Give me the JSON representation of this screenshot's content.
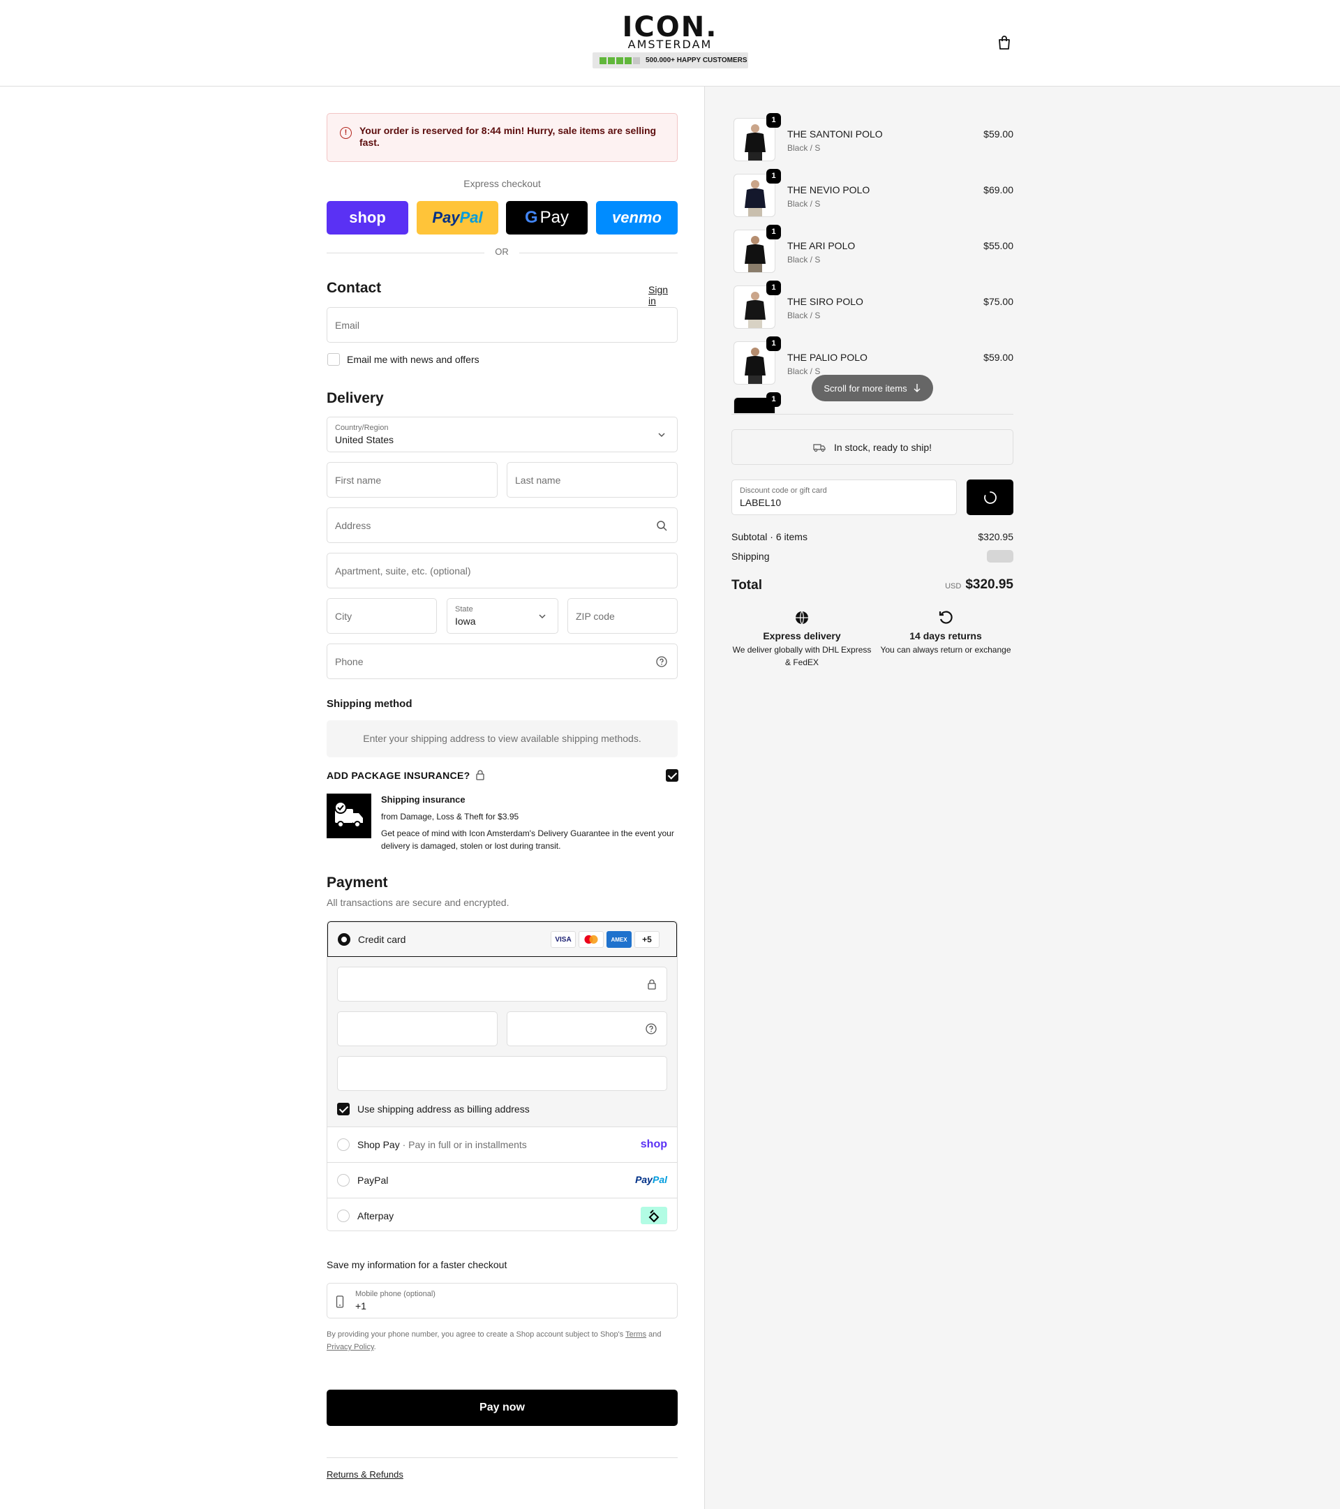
{
  "header": {
    "logo_main": "ICON.",
    "logo_sub": "AMSTERDAM",
    "trust_text": "500.000+ HAPPY CUSTOMERS",
    "trust_rating_stars": 4,
    "trust_rating_max": 5
  },
  "alert": {
    "icon": "alert-circle-icon",
    "text": "Your order is reserved for 8:44 min! Hurry, sale items are selling fast."
  },
  "express": {
    "label": "Express checkout",
    "shop": "shop",
    "paypal_a": "Pay",
    "paypal_b": "Pal",
    "gpay_g": "G",
    "gpay": "Pay",
    "venmo": "venmo",
    "or": "OR"
  },
  "contact": {
    "title": "Contact",
    "sign_in": "Sign in",
    "email_placeholder": "Email",
    "news_label": "Email me with news and offers"
  },
  "delivery": {
    "title": "Delivery",
    "country_label": "Country/Region",
    "country_value": "United States",
    "first_name": "First name",
    "last_name": "Last name",
    "address": "Address",
    "apartment": "Apartment, suite, etc. (optional)",
    "city": "City",
    "state_label": "State",
    "state_value": "Iowa",
    "zip": "ZIP code",
    "phone": "Phone"
  },
  "shipping_method": {
    "title": "Shipping method",
    "message": "Enter your shipping address to view available shipping methods."
  },
  "insurance": {
    "title": "ADD PACKAGE INSURANCE?",
    "checked": true,
    "heading": "Shipping insurance",
    "sub": "from Damage, Loss & Theft for $3.95",
    "desc": "Get peace of mind with Icon Amsterdam's Delivery Guarantee in the event your delivery is damaged, stolen or lost during transit."
  },
  "payment": {
    "title": "Payment",
    "subtitle": "All transactions are secure and encrypted.",
    "credit_card": "Credit card",
    "cards": [
      "VISA",
      "AMEX",
      "+5"
    ],
    "billing_label": "Use shipping address as billing address",
    "shop_pay": "Shop Pay",
    "shop_pay_sub": "· Pay in full or in installments",
    "shop_brand": "shop",
    "paypal": "PayPal",
    "paypal_brand_a": "Pay",
    "paypal_brand_b": "Pal",
    "afterpay": "Afterpay"
  },
  "save_info": {
    "label": "Save my information for a faster checkout",
    "mobile_label": "Mobile phone (optional)",
    "mobile_value": "+1",
    "legal_a": "By providing your phone number, you agree to create a Shop account subject to Shop's",
    "legal_terms": "Terms",
    "legal_and": "and",
    "legal_privacy": "Privacy Policy",
    "legal_end": "."
  },
  "pay_now": "Pay now",
  "footer_link": "Returns & Refunds",
  "summary": {
    "items": [
      {
        "name": "THE SANTONI POLO",
        "variant": "Black / S",
        "price": "$59.00",
        "qty": "1"
      },
      {
        "name": "THE NEVIO POLO",
        "variant": "Black / S",
        "price": "$69.00",
        "qty": "1"
      },
      {
        "name": "THE ARI POLO",
        "variant": "Black / S",
        "price": "$55.00",
        "qty": "1"
      },
      {
        "name": "THE SIRO POLO",
        "variant": "Black / S",
        "price": "$75.00",
        "qty": "1"
      },
      {
        "name": "THE PALIO POLO",
        "variant": "Black / S",
        "price": "$59.00",
        "qty": "1"
      },
      {
        "name": "",
        "variant": "",
        "price": "",
        "qty": "1"
      }
    ],
    "scroll_pill": "Scroll for more items",
    "stock": "In stock, ready to ship!",
    "discount_label": "Discount code or gift card",
    "discount_value": "LABEL10",
    "subtotal_label": "Subtotal · 6 items",
    "subtotal_value": "$320.95",
    "shipping_label": "Shipping",
    "total_label": "Total",
    "currency": "USD",
    "total_value": "$320.95",
    "feature1_title": "Express delivery",
    "feature1_desc": "We deliver globally with DHL Express & FedEX",
    "feature2_title": "14 days returns",
    "feature2_desc": "You can always return or exchange"
  },
  "colors": {
    "accent": "#000000",
    "shop": "#5a31f4",
    "paypal": "#ffc439",
    "venmo": "#008cff",
    "alert_bg": "#fdf2f2",
    "trust_green": "#61b73b",
    "afterpay": "#b2fce4"
  }
}
